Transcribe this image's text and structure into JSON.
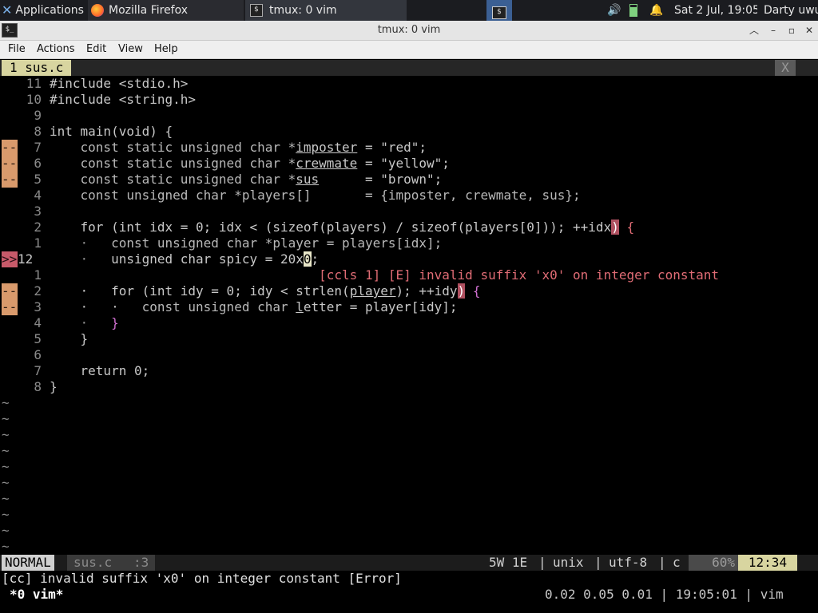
{
  "panel": {
    "applications": "Applications",
    "tasks": [
      "Mozilla Firefox",
      "tmux: 0 vim"
    ],
    "clock": "Sat  2 Jul, 19:05",
    "user": "Darty uwu"
  },
  "window": {
    "title": "tmux: 0 vim",
    "menu": [
      "File",
      "Actions",
      "Edit",
      "View",
      "Help"
    ]
  },
  "vim": {
    "tab": "1 sus.c",
    "tab_close": "X",
    "lines": [
      {
        "n": "11",
        "sign": "",
        "parts": [
          [
            "#include <stdio.h>",
            ""
          ]
        ]
      },
      {
        "n": "10",
        "sign": "",
        "parts": [
          [
            "#include <string.h>",
            ""
          ]
        ]
      },
      {
        "n": "9",
        "sign": "",
        "parts": []
      },
      {
        "n": "8",
        "sign": "",
        "parts": [
          [
            "int main(void) {",
            ""
          ]
        ]
      },
      {
        "n": "7",
        "sign": "--",
        "parts": [
          [
            "    const static unsigned char *",
            "kw"
          ],
          [
            "imposter",
            "ul"
          ],
          [
            " = \"red\";",
            ""
          ]
        ]
      },
      {
        "n": "6",
        "sign": "--",
        "parts": [
          [
            "    const static unsigned char *",
            "kw"
          ],
          [
            "crewmate",
            "ul"
          ],
          [
            " = \"yellow\";",
            ""
          ]
        ]
      },
      {
        "n": "5",
        "sign": "--",
        "parts": [
          [
            "    const static unsigned char *",
            "kw"
          ],
          [
            "sus",
            "ul"
          ],
          [
            "      = \"brown\";",
            ""
          ]
        ]
      },
      {
        "n": "4",
        "sign": "",
        "parts": [
          [
            "    const unsigned char *players[]       = {imposter, crewmate, sus};",
            "kw"
          ]
        ]
      },
      {
        "n": "3",
        "sign": "",
        "parts": []
      },
      {
        "n": "2",
        "sign": "",
        "parts": [
          [
            "    for (int idx = 0; idx < (sizeof(players) / sizeof(players[0])); ++idx",
            ""
          ],
          [
            ")",
            "hlb"
          ],
          [
            " {",
            "red"
          ]
        ]
      },
      {
        "n": "1",
        "sign": "",
        "parts": [
          [
            "    ·   ",
            "dim"
          ],
          [
            "const unsigned char *player = players[idx];",
            "kw"
          ]
        ]
      },
      {
        "n": "12",
        "sign": ">>",
        "cur": true,
        "parts": [
          [
            "    ·   ",
            "dim"
          ],
          [
            "unsigned char spicy = 20x",
            ""
          ],
          [
            "0",
            "cursor"
          ],
          [
            ";",
            ""
          ]
        ]
      },
      {
        "n": "1",
        "sign": "",
        "parts": [
          [
            "                                   [ccls 1] [E] invalid suffix 'x0' on integer constant",
            "red"
          ]
        ]
      },
      {
        "n": "2",
        "sign": "--",
        "parts": [
          [
            "    ·   for (int idy = 0; idy < strlen(",
            ""
          ],
          [
            "player",
            "ul"
          ],
          [
            "); ++idy",
            ""
          ],
          [
            ")",
            "hlb"
          ],
          [
            " {",
            "mag"
          ]
        ]
      },
      {
        "n": "3",
        "sign": "--",
        "parts": [
          [
            "    ·   ·   const unsigned char ",
            "kw"
          ],
          [
            "l",
            "ul"
          ],
          [
            "etter = player[idy];",
            ""
          ]
        ]
      },
      {
        "n": "4",
        "sign": "",
        "parts": [
          [
            "    ·   ",
            "dim"
          ],
          [
            "}",
            "mag"
          ]
        ]
      },
      {
        "n": "5",
        "sign": "",
        "parts": [
          [
            "    }",
            ""
          ]
        ]
      },
      {
        "n": "6",
        "sign": "",
        "parts": []
      },
      {
        "n": "7",
        "sign": "",
        "parts": [
          [
            "    return 0;",
            ""
          ]
        ]
      },
      {
        "n": "8",
        "sign": "",
        "parts": [
          [
            "}",
            ""
          ]
        ]
      }
    ],
    "tilde": "~",
    "tilde_count": 10,
    "status": {
      "mode": "NORMAL",
      "file": "sus.c",
      "col": ":3",
      "diag": "5W 1E",
      "fileformat": "unix",
      "encoding": "utf-8",
      "filetype": "c",
      "percent": "60%",
      "position": "12:34",
      "sep": "|"
    },
    "message": "[cc] invalid suffix 'x0' on integer constant [Error]"
  },
  "tmux": {
    "window": "*0 vim*",
    "right": "0.02 0.05 0.01 | 19:05:01 | vim"
  },
  "colors": {
    "panel": "#1b1c20",
    "tab": "#d8d5a0",
    "sign_change": "#d99a6c",
    "sign_error": "#c85a6a",
    "status_mode": "#d0d0d0",
    "status_pos": "#d8d5a0",
    "error_text": "#e06c75"
  }
}
